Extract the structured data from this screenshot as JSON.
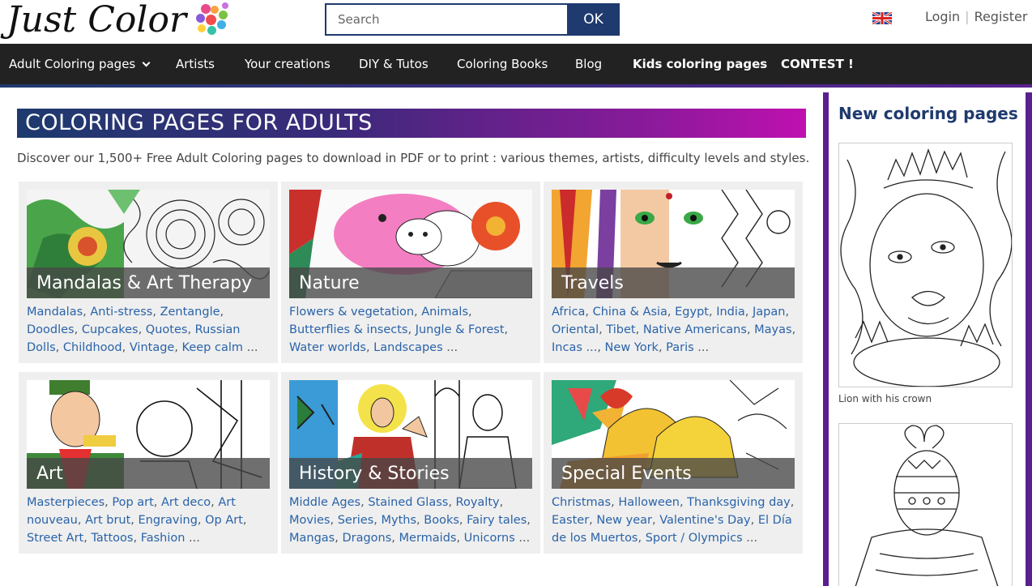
{
  "brand": {
    "logo_text": "Just Color"
  },
  "search": {
    "placeholder": "Search",
    "button_label": "OK"
  },
  "auth": {
    "login": "Login",
    "separator": "|",
    "register": "Register"
  },
  "nav": {
    "items": [
      {
        "label": "Adult Coloring pages",
        "dropdown": true,
        "bold": false
      },
      {
        "label": "Artists",
        "bold": false
      },
      {
        "label": "Your creations",
        "bold": false
      },
      {
        "label": "DIY & Tutos",
        "bold": false
      },
      {
        "label": "Coloring Books",
        "bold": false
      },
      {
        "label": "Blog",
        "bold": false
      },
      {
        "label": "Kids coloring pages",
        "bold": true
      },
      {
        "label": "CONTEST !",
        "bold": true
      }
    ]
  },
  "main": {
    "banner": "COLORING PAGES FOR ADULTS",
    "intro": "Discover our 1,500+ Free Adult Coloring pages to download in PDF or to print : various themes, artists, difficulty levels and styles.",
    "categories": [
      {
        "title": "Mandalas & Art Therapy",
        "links": [
          "Mandalas",
          "Anti-stress",
          "Zentangle",
          "Doodles",
          "Cupcakes",
          "Quotes",
          "Russian Dolls",
          "Childhood",
          "Vintage",
          "Keep calm"
        ],
        "more": "..."
      },
      {
        "title": "Nature",
        "links": [
          "Flowers & vegetation",
          "Animals",
          "Butterflies & insects",
          "Jungle & Forest",
          "Water worlds",
          "Landscapes"
        ],
        "more": "..."
      },
      {
        "title": "Travels",
        "links": [
          "Africa",
          "China & Asia",
          "Egypt",
          "India",
          "Japan",
          "Oriental",
          "Tibet",
          "Native Americans",
          "Mayas",
          "Incas ...",
          "New York",
          "Paris"
        ],
        "more": "..."
      },
      {
        "title": "Art",
        "links": [
          "Masterpieces",
          "Pop art",
          "Art deco",
          "Art nouveau",
          "Art brut",
          "Engraving",
          "Op Art",
          "Street Art",
          "Tattoos",
          "Fashion"
        ],
        "more": "..."
      },
      {
        "title": "History & Stories",
        "links": [
          "Middle Ages",
          "Stained Glass",
          "Royalty",
          "Movies",
          "Series",
          "Myths",
          "Books",
          "Fairy tales",
          "Mangas",
          "Dragons",
          "Mermaids",
          "Unicorns"
        ],
        "more": "..."
      },
      {
        "title": "Special Events",
        "links": [
          "Christmas",
          "Halloween",
          "Thanksgiving day",
          "Easter",
          "New year",
          "Valentine's Day",
          "El Día de los Muertos",
          "Sport / Olympics"
        ],
        "more": "..."
      }
    ]
  },
  "sidebar": {
    "title": "New coloring pages",
    "items": [
      {
        "caption": "Lion with his crown"
      },
      {
        "caption": ""
      }
    ]
  },
  "colors": {
    "navy": "#1e3a6e",
    "purple": "#5a2090",
    "magenta": "#c010b0",
    "link": "#2a63a8",
    "navbar": "#222222"
  },
  "icons": [
    "uk-flag-icon",
    "chevron-down-icon"
  ]
}
